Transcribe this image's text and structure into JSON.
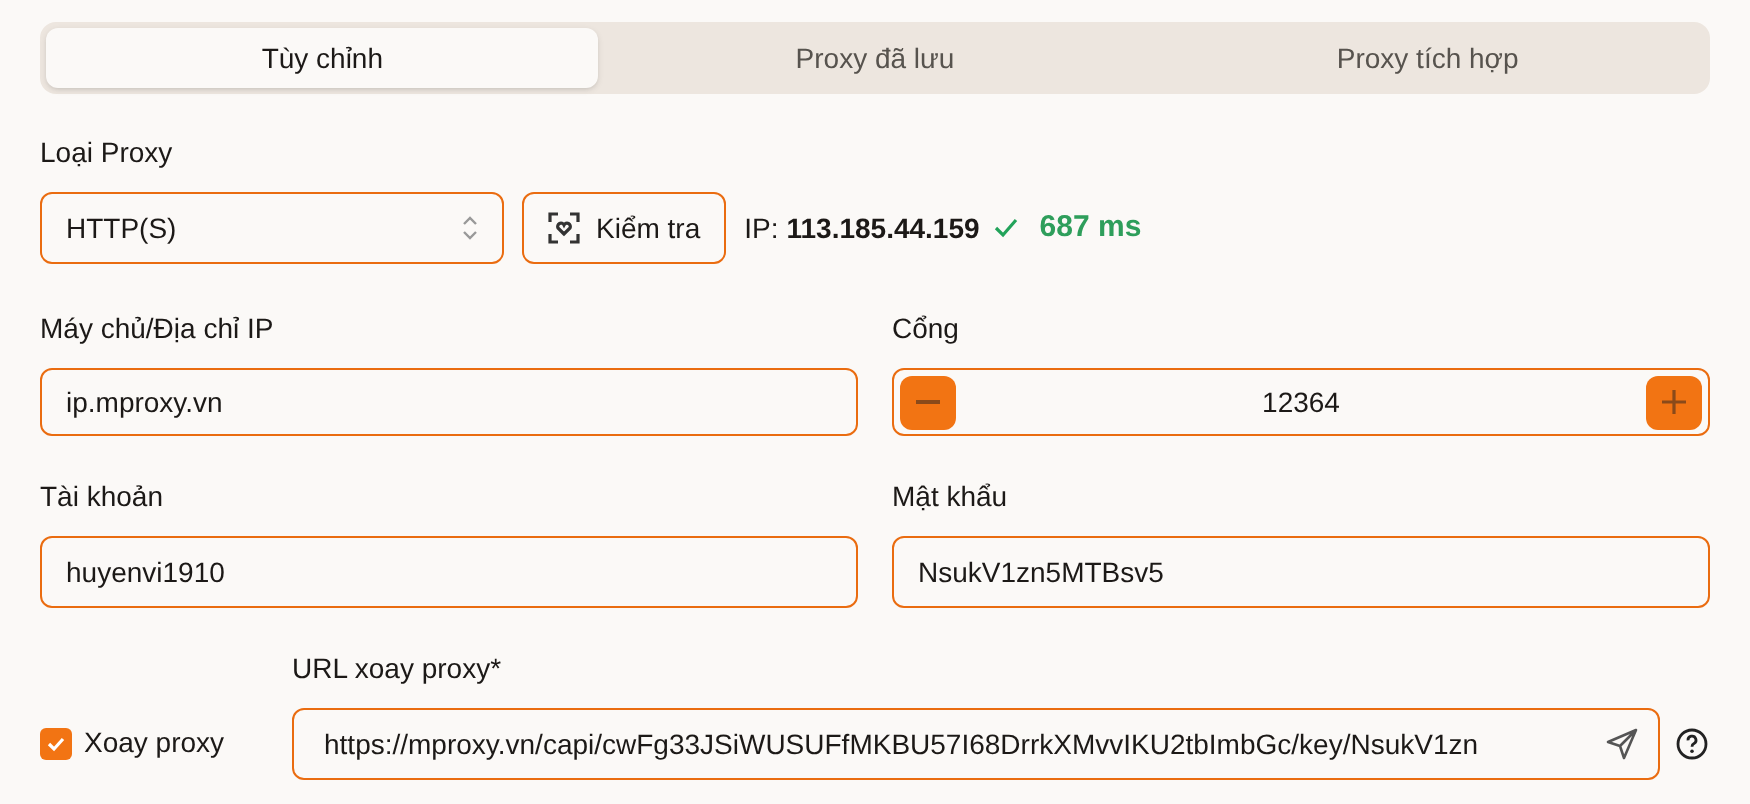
{
  "tabs": [
    {
      "label": "Tùy chỉnh",
      "selected": true
    },
    {
      "label": "Proxy đã lưu",
      "selected": false
    },
    {
      "label": "Proxy tích hợp",
      "selected": false
    }
  ],
  "proxy_type": {
    "label": "Loại Proxy",
    "value": "HTTP(S)"
  },
  "check_button": {
    "label": "Kiểm tra"
  },
  "check_result": {
    "ip_label": "IP:",
    "ip": "113.185.44.159",
    "ok": true,
    "latency": "687 ms"
  },
  "host": {
    "label": "Máy chủ/Địa chỉ IP",
    "value": "ip.mproxy.vn"
  },
  "port": {
    "label": "Cổng",
    "value": "12364"
  },
  "username": {
    "label": "Tài khoản",
    "value": "huyenvi1910"
  },
  "password": {
    "label": "Mật khẩu",
    "value": "NsukV1zn5MTBsv5"
  },
  "rotate": {
    "label": "Xoay proxy",
    "checked": true
  },
  "rotate_url": {
    "label": "URL xoay proxy*",
    "value": "https://mproxy.vn/capi/cwFg33JSiWUSUFfMKBU57I68DrrkXMvvIKU2tbImbGc/key/NsukV1zn"
  }
}
